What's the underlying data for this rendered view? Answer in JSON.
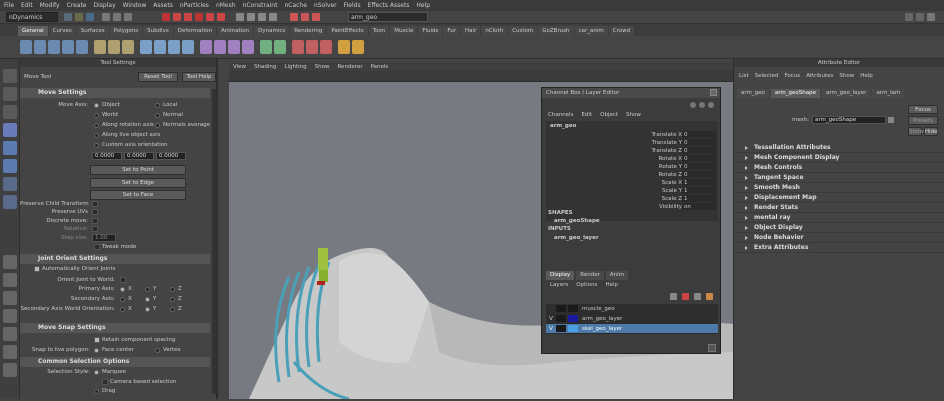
{
  "menubar": [
    "File",
    "Edit",
    "Modify",
    "Create",
    "Display",
    "Window",
    "Assets",
    "nParticles",
    "nMesh",
    "nConstraint",
    "nCache",
    "nSolver",
    "Fields",
    "Effects Assets",
    "Help"
  ],
  "status": {
    "mode": "nDynamics",
    "object_field": "arm_geo"
  },
  "shelf_tabs": [
    "General",
    "Curves",
    "Surfaces",
    "Polygons",
    "Subdivs",
    "Deformation",
    "Animation",
    "Dynamics",
    "Rendering",
    "PaintEffects",
    "Toon",
    "Muscle",
    "Fluids",
    "Fur",
    "Hair",
    "nCloth",
    "Custom",
    "GoZBrush",
    "car_anim",
    "Crowd"
  ],
  "shelf_active": "General",
  "tool_settings": {
    "header": "Tool Settings",
    "tool_name": "Move Tool",
    "reset_label": "Reset Tool",
    "help_label": "Tool Help",
    "move_settings": {
      "title": "Move Settings",
      "move_axis_label": "Move Axis:",
      "opt_object": "Object",
      "opt_local": "Local",
      "opt_world": "World",
      "opt_normal": "Normal",
      "opt_rot_axis": "Along rotation axis",
      "opt_normals_avg": "Normals average",
      "opt_live_axis": "Along live object axis",
      "opt_custom": "Custom axis orientation",
      "v1": "0.0000",
      "v2": "0.0000",
      "v3": "0.0000",
      "set_point": "Set to Point",
      "set_edge": "Set to Edge",
      "set_face": "Set to Face",
      "preserve_child": "Preserve Child Transform",
      "preserve_uvs": "Preserve UVs",
      "discrete_move": "Discrete move:",
      "relative": "Relative:",
      "step_size": "Step size:",
      "step_val": "1.00",
      "tweak_mode": "Tweak mode"
    },
    "joint_orient": {
      "title": "Joint Orient Settings",
      "auto_orient": "Automatically Orient Joints",
      "orient_world": "Orient Joint to World:",
      "primary": "Primary Axis:",
      "secondary": "Secondary Axis:",
      "sec_world": "Secondary Axis World Orientation:",
      "x": "X",
      "y": "Y",
      "z": "Z"
    },
    "snap": {
      "title": "Move Snap Settings",
      "retain": "Retain component spacing",
      "snap_live": "Snap to live polygon:",
      "face_center": "Face center",
      "vertex": "Vertex"
    },
    "common": {
      "title": "Common Selection Options",
      "sel_style": "Selection Style:",
      "marquee": "Marquee",
      "camera_based": "Camera based selection",
      "drag": "Drag"
    }
  },
  "viewport_menu": [
    "View",
    "Shading",
    "Lighting",
    "Show",
    "Renderer",
    "Panels"
  ],
  "channel_box": {
    "title": "Channel Box / Layer Editor",
    "menu": [
      "Channels",
      "Edit",
      "Object",
      "Show"
    ],
    "object": "arm_geo",
    "channels": [
      {
        "name": "Translate X",
        "value": "0"
      },
      {
        "name": "Translate Y",
        "value": "0"
      },
      {
        "name": "Translate Z",
        "value": "0"
      },
      {
        "name": "Rotate X",
        "value": "0"
      },
      {
        "name": "Rotate Y",
        "value": "0"
      },
      {
        "name": "Rotate Z",
        "value": "0"
      },
      {
        "name": "Scale X",
        "value": "1"
      },
      {
        "name": "Scale Y",
        "value": "1"
      },
      {
        "name": "Scale Z",
        "value": "1"
      },
      {
        "name": "Visibility",
        "value": "on"
      }
    ],
    "shapes_label": "SHAPES",
    "shape": "arm_geoShape",
    "inputs_label": "INPUTS",
    "input": "arm_geo_layer",
    "tabs": [
      "Display",
      "Render",
      "Anim"
    ],
    "layer_menu": [
      "Layers",
      "Options",
      "Help"
    ],
    "layers": [
      {
        "v": "",
        "name": "muscle_geo",
        "color": "#1a1a1a"
      },
      {
        "v": "V",
        "name": "arm_geo_layer",
        "color": "#1a1aa0"
      },
      {
        "v": "V",
        "name": "skel_geo_layer",
        "color": "#4aa0e0"
      }
    ]
  },
  "attr_editor": {
    "title": "Attribute Editor",
    "menu": [
      "List",
      "Selected",
      "Focus",
      "Attributes",
      "Show",
      "Help"
    ],
    "tabs": [
      "arm_geo",
      "arm_geoShape",
      "arm_geo_layer",
      "arm_lam"
    ],
    "mesh_label": "mesh:",
    "mesh_value": "arm_geoShape",
    "focus_btn": "Focus",
    "presets_btn": "Presets",
    "show_btn": "Show",
    "hide_btn": "Hide",
    "sections": [
      "Tessellation Attributes",
      "Mesh Component Display",
      "Mesh Controls",
      "Tangent Space",
      "Smooth Mesh",
      "Displacement Map",
      "Render Stats",
      "mental ray",
      "Object Display",
      "Node Behavior",
      "Extra Attributes"
    ]
  },
  "colors": {
    "accent": "#c23030",
    "selection": "#4d7aa8"
  }
}
